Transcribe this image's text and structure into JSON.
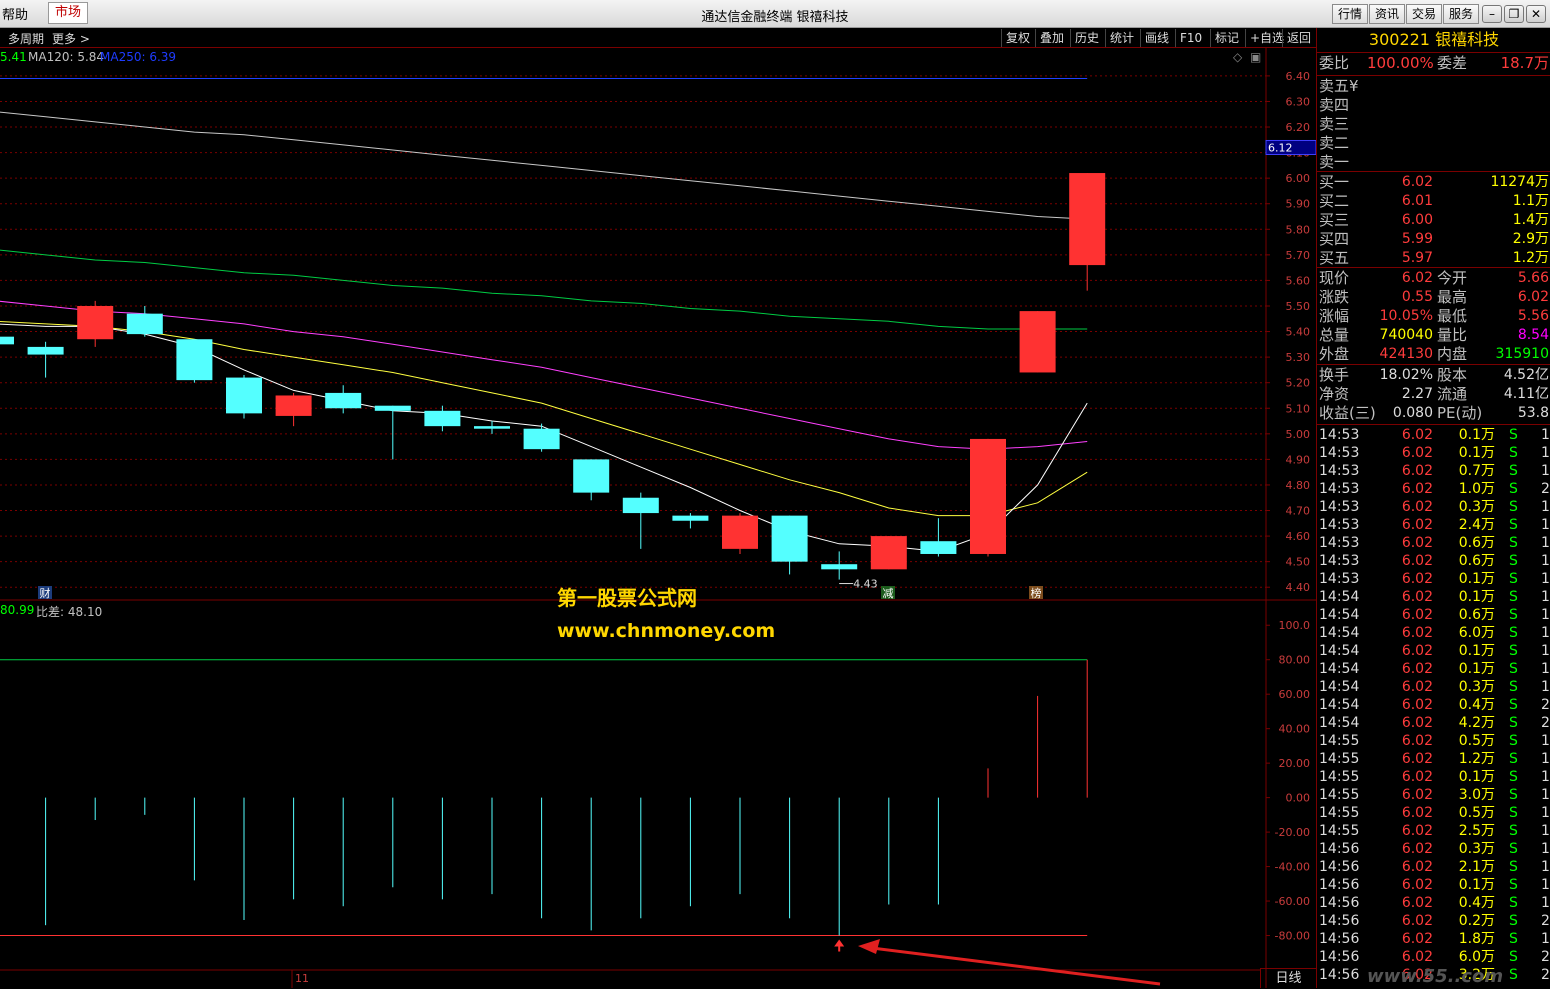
{
  "titlebar": {
    "help_menu": "帮助",
    "market_menu": "市场",
    "app_title": "通达信金融终端  银禧科技",
    "buttons": [
      "行情",
      "资讯",
      "交易",
      "服务"
    ]
  },
  "toolbar": {
    "multi_period": "多周期",
    "more": "更多 >",
    "buttons": [
      "复权",
      "叠加",
      "历史",
      "统计",
      "画线",
      "F10",
      "标记",
      "+自选",
      "返回"
    ]
  },
  "ma_legend": [
    {
      "text": "5.41",
      "color": "#00ff00"
    },
    {
      "text": "MA120: 5.84",
      "color": "#c0c0c0"
    },
    {
      "text": "MA250: 6.39",
      "color": "#1e3cff"
    }
  ],
  "indicator_legend": [
    {
      "text": "80.99",
      "color": "#00ff00"
    },
    {
      "text": "比差: 48.10",
      "color": "#c0c0c0"
    }
  ],
  "price_axis": [
    "6.40",
    "6.30",
    "6.20",
    "6.10",
    "6.00",
    "5.90",
    "5.80",
    "5.70",
    "5.60",
    "5.50",
    "5.40",
    "5.30",
    "5.20",
    "5.10",
    "5.00",
    "4.90",
    "4.80",
    "4.70",
    "4.60",
    "4.50",
    "4.40"
  ],
  "price_axis_highlight": "6.12",
  "indicator_axis": [
    "100.0",
    "80.00",
    "60.00",
    "40.00",
    "20.00",
    "0.00",
    "-20.00",
    "-40.00",
    "-60.00",
    "-80.00"
  ],
  "low_marker": "4.43",
  "event_labels": {
    "cai": "财",
    "jian": "减",
    "bang": "榜"
  },
  "date_label": "11",
  "period_label": "日线",
  "candles": [
    {
      "o": 5.38,
      "c": 5.35,
      "h": 5.38,
      "l": 5.35
    },
    {
      "o": 5.34,
      "c": 5.31,
      "h": 5.36,
      "l": 5.22
    },
    {
      "o": 5.37,
      "c": 5.5,
      "h": 5.52,
      "l": 5.34
    },
    {
      "o": 5.47,
      "c": 5.39,
      "h": 5.5,
      "l": 5.38
    },
    {
      "o": 5.37,
      "c": 5.21,
      "h": 5.37,
      "l": 5.2
    },
    {
      "o": 5.22,
      "c": 5.08,
      "h": 5.23,
      "l": 5.06
    },
    {
      "o": 5.07,
      "c": 5.15,
      "h": 5.16,
      "l": 5.03
    },
    {
      "o": 5.16,
      "c": 5.1,
      "h": 5.19,
      "l": 5.08
    },
    {
      "o": 5.11,
      "c": 5.09,
      "h": 5.11,
      "l": 4.9
    },
    {
      "o": 5.09,
      "c": 5.03,
      "h": 5.11,
      "l": 5.01
    },
    {
      "o": 5.03,
      "c": 5.02,
      "h": 5.05,
      "l": 5.0
    },
    {
      "o": 5.02,
      "c": 4.94,
      "h": 5.04,
      "l": 4.93
    },
    {
      "o": 4.9,
      "c": 4.77,
      "h": 4.9,
      "l": 4.74
    },
    {
      "o": 4.75,
      "c": 4.69,
      "h": 4.77,
      "l": 4.55
    },
    {
      "o": 4.68,
      "c": 4.66,
      "h": 4.69,
      "l": 4.63
    },
    {
      "o": 4.55,
      "c": 4.68,
      "h": 4.69,
      "l": 4.53
    },
    {
      "o": 4.68,
      "c": 4.5,
      "h": 4.68,
      "l": 4.45
    },
    {
      "o": 4.49,
      "c": 4.47,
      "h": 4.54,
      "l": 4.43
    },
    {
      "o": 4.47,
      "c": 4.6,
      "h": 4.6,
      "l": 4.47
    },
    {
      "o": 4.58,
      "c": 4.53,
      "h": 4.67,
      "l": 4.52
    },
    {
      "o": 4.53,
      "c": 4.98,
      "h": 4.98,
      "l": 4.52
    },
    {
      "o": 5.24,
      "c": 5.48,
      "h": 5.48,
      "l": 5.24
    },
    {
      "o": 5.66,
      "c": 6.02,
      "h": 6.02,
      "l": 5.56
    }
  ],
  "ma_lines": {
    "ma250": [
      6.39,
      6.39,
      6.39,
      6.39,
      6.39,
      6.39,
      6.39,
      6.39,
      6.39,
      6.39,
      6.39,
      6.39,
      6.39,
      6.39,
      6.39,
      6.39,
      6.39,
      6.39,
      6.39,
      6.39,
      6.39,
      6.39,
      6.39
    ],
    "ma120": [
      6.26,
      6.24,
      6.22,
      6.2,
      6.18,
      6.17,
      6.15,
      6.13,
      6.11,
      6.09,
      6.07,
      6.05,
      6.03,
      6.01,
      5.99,
      5.97,
      5.95,
      5.93,
      5.91,
      5.89,
      5.87,
      5.85,
      5.84
    ],
    "green": [
      5.72,
      5.7,
      5.68,
      5.67,
      5.65,
      5.63,
      5.62,
      5.6,
      5.58,
      5.57,
      5.55,
      5.54,
      5.52,
      5.51,
      5.49,
      5.48,
      5.46,
      5.45,
      5.44,
      5.42,
      5.41,
      5.41,
      5.41
    ],
    "magenta": [
      5.52,
      5.5,
      5.48,
      5.47,
      5.45,
      5.43,
      5.4,
      5.38,
      5.35,
      5.32,
      5.29,
      5.26,
      5.22,
      5.18,
      5.14,
      5.1,
      5.06,
      5.02,
      4.98,
      4.95,
      4.94,
      4.95,
      4.97
    ],
    "yellow": [
      5.44,
      5.43,
      5.42,
      5.4,
      5.37,
      5.33,
      5.3,
      5.27,
      5.24,
      5.2,
      5.16,
      5.12,
      5.06,
      5.0,
      4.94,
      4.88,
      4.82,
      4.77,
      4.71,
      4.68,
      4.68,
      4.73,
      4.85
    ],
    "white": [
      5.43,
      5.42,
      5.42,
      5.39,
      5.34,
      5.25,
      5.17,
      5.13,
      5.09,
      5.08,
      5.05,
      5.03,
      4.95,
      4.87,
      4.79,
      4.7,
      4.62,
      4.57,
      4.56,
      4.54,
      4.61,
      4.8,
      5.12
    ]
  },
  "indicator_bars": [
    -74,
    -13,
    -10,
    -48,
    -71,
    -59,
    -63,
    -52,
    -59,
    -56,
    -70,
    -77,
    -70,
    -63,
    -56,
    -70,
    -80,
    -62,
    -62,
    17,
    59,
    80
  ],
  "indicator_line": 80,
  "indicator_low_line": -80,
  "quote": {
    "code_name": "300221  银禧科技",
    "weibi_label": "委比",
    "weibi": "100.00%",
    "weicha_label": "委差",
    "weicha": "18.7万",
    "sells": [
      {
        "label": "卖五",
        "suffix": "¥"
      },
      {
        "label": "卖四",
        "suffix": ""
      },
      {
        "label": "卖三",
        "suffix": ""
      },
      {
        "label": "卖二",
        "suffix": ""
      },
      {
        "label": "卖一",
        "suffix": ""
      }
    ],
    "buys": [
      {
        "label": "买一",
        "price": "6.02",
        "vol": "11274万"
      },
      {
        "label": "买二",
        "price": "6.01",
        "vol": "1.1万"
      },
      {
        "label": "买三",
        "price": "6.00",
        "vol": "1.4万"
      },
      {
        "label": "买四",
        "price": "5.99",
        "vol": "2.9万"
      },
      {
        "label": "买五",
        "price": "5.97",
        "vol": "1.2万"
      }
    ],
    "stats": [
      {
        "l1": "现价",
        "v1": "6.02",
        "c1": "#ff3c3c",
        "l2": "今开",
        "v2": "5.66",
        "c2": "#ff3c3c"
      },
      {
        "l1": "涨跌",
        "v1": "0.55",
        "c1": "#ff3c3c",
        "l2": "最高",
        "v2": "6.02",
        "c2": "#ff3c3c"
      },
      {
        "l1": "涨幅",
        "v1": "10.05%",
        "c1": "#ff3c3c",
        "l2": "最低",
        "v2": "5.56",
        "c2": "#ff3c3c"
      },
      {
        "l1": "总量",
        "v1": "740040",
        "c1": "#ffff00",
        "l2": "量比",
        "v2": "8.54",
        "c2": "#ff00ff"
      },
      {
        "l1": "外盘",
        "v1": "424130",
        "c1": "#ff3c3c",
        "l2": "内盘",
        "v2": "315910",
        "c2": "#00ff00"
      }
    ],
    "stats2": [
      {
        "l1": "换手",
        "v1": "18.02%",
        "l2": "股本",
        "v2": "4.52亿"
      },
      {
        "l1": "净资",
        "v1": "2.27",
        "l2": "流通",
        "v2": "4.11亿"
      },
      {
        "l1": "收益(三)",
        "v1": "0.080",
        "l2": "PE(动)",
        "v2": "53.8"
      }
    ],
    "ticks": [
      {
        "t": "14:53",
        "p": "6.02",
        "v": "0.1万",
        "s": "S",
        "n": "1"
      },
      {
        "t": "14:53",
        "p": "6.02",
        "v": "0.1万",
        "s": "S",
        "n": "1"
      },
      {
        "t": "14:53",
        "p": "6.02",
        "v": "0.7万",
        "s": "S",
        "n": "1"
      },
      {
        "t": "14:53",
        "p": "6.02",
        "v": "1.0万",
        "s": "S",
        "n": "2"
      },
      {
        "t": "14:53",
        "p": "6.02",
        "v": "0.3万",
        "s": "S",
        "n": "1"
      },
      {
        "t": "14:53",
        "p": "6.02",
        "v": "2.4万",
        "s": "S",
        "n": "1"
      },
      {
        "t": "14:53",
        "p": "6.02",
        "v": "0.6万",
        "s": "S",
        "n": "1"
      },
      {
        "t": "14:53",
        "p": "6.02",
        "v": "0.6万",
        "s": "S",
        "n": "1"
      },
      {
        "t": "14:53",
        "p": "6.02",
        "v": "0.1万",
        "s": "S",
        "n": "1"
      },
      {
        "t": "14:54",
        "p": "6.02",
        "v": "0.1万",
        "s": "S",
        "n": "1"
      },
      {
        "t": "14:54",
        "p": "6.02",
        "v": "0.6万",
        "s": "S",
        "n": "1"
      },
      {
        "t": "14:54",
        "p": "6.02",
        "v": "6.0万",
        "s": "S",
        "n": "1"
      },
      {
        "t": "14:54",
        "p": "6.02",
        "v": "0.1万",
        "s": "S",
        "n": "1"
      },
      {
        "t": "14:54",
        "p": "6.02",
        "v": "0.1万",
        "s": "S",
        "n": "1"
      },
      {
        "t": "14:54",
        "p": "6.02",
        "v": "0.3万",
        "s": "S",
        "n": "1"
      },
      {
        "t": "14:54",
        "p": "6.02",
        "v": "0.4万",
        "s": "S",
        "n": "2"
      },
      {
        "t": "14:54",
        "p": "6.02",
        "v": "4.2万",
        "s": "S",
        "n": "2"
      },
      {
        "t": "14:55",
        "p": "6.02",
        "v": "0.5万",
        "s": "S",
        "n": "1"
      },
      {
        "t": "14:55",
        "p": "6.02",
        "v": "1.2万",
        "s": "S",
        "n": "1"
      },
      {
        "t": "14:55",
        "p": "6.02",
        "v": "0.1万",
        "s": "S",
        "n": "1"
      },
      {
        "t": "14:55",
        "p": "6.02",
        "v": "3.0万",
        "s": "S",
        "n": "1"
      },
      {
        "t": "14:55",
        "p": "6.02",
        "v": "0.5万",
        "s": "S",
        "n": "1"
      },
      {
        "t": "14:55",
        "p": "6.02",
        "v": "2.5万",
        "s": "S",
        "n": "1"
      },
      {
        "t": "14:56",
        "p": "6.02",
        "v": "0.3万",
        "s": "S",
        "n": "1"
      },
      {
        "t": "14:56",
        "p": "6.02",
        "v": "2.1万",
        "s": "S",
        "n": "1"
      },
      {
        "t": "14:56",
        "p": "6.02",
        "v": "0.1万",
        "s": "S",
        "n": "1"
      },
      {
        "t": "14:56",
        "p": "6.02",
        "v": "0.4万",
        "s": "S",
        "n": "1"
      },
      {
        "t": "14:56",
        "p": "6.02",
        "v": "0.2万",
        "s": "S",
        "n": "2"
      },
      {
        "t": "14:56",
        "p": "6.02",
        "v": "1.8万",
        "s": "S",
        "n": "1"
      },
      {
        "t": "14:56",
        "p": "6.02",
        "v": "6.0万",
        "s": "S",
        "n": "2"
      },
      {
        "t": "14:56",
        "p": "6.02",
        "v": "3.2万",
        "s": "S",
        "n": "2"
      }
    ]
  },
  "watermark": {
    "line1": "第一股票公式网",
    "line2": "www.chnmoney.com",
    "corner": "www.55..com"
  },
  "colors": {
    "up": "#ff3232",
    "down": "#54ffff",
    "grid": "#7a0000",
    "axis_text": "#c83c3c"
  }
}
